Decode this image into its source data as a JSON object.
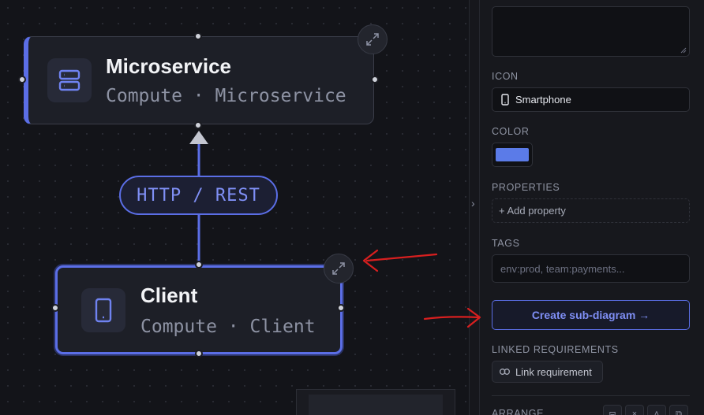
{
  "canvas": {
    "nodes": [
      {
        "title": "Microservice",
        "subtitle": "Compute · Microservice",
        "icon": "server-icon"
      },
      {
        "title": "Client",
        "subtitle": "Compute · Client",
        "icon": "smartphone-icon"
      }
    ],
    "edge": {
      "label": "HTTP / REST"
    }
  },
  "panel": {
    "icon_label": "ICON",
    "icon_value": "Smartphone",
    "color_label": "COLOR",
    "color_value": "#5b7be8",
    "properties_label": "PROPERTIES",
    "add_property": "+ Add property",
    "tags_label": "TAGS",
    "tags_placeholder": "env:prod, team:payments...",
    "create_subdiagram": "Create sub-diagram →",
    "linked_req_label": "LINKED REQUIREMENTS",
    "link_requirement": "Link requirement",
    "arrange_label": "ARRANGE"
  },
  "colors": {
    "accent": "#5b6ee6",
    "annotation": "#d81f1f"
  }
}
